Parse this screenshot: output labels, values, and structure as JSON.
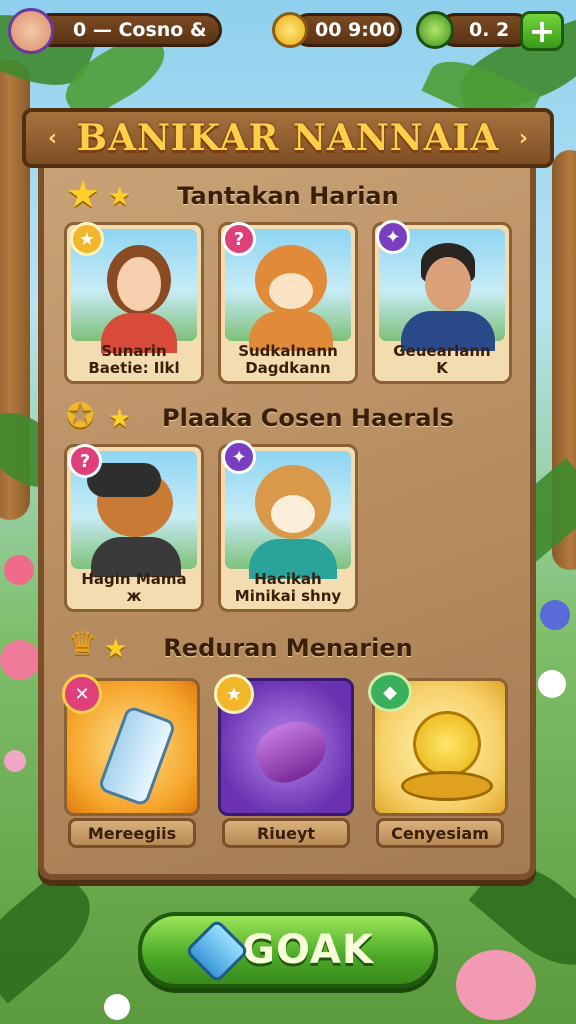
{
  "topbar": {
    "player_name": "0 — Cosno &",
    "coins": "00 9:00",
    "gems": "0. 2",
    "add_icon": "plus-icon"
  },
  "banner": {
    "title": "BANIKAR NANNAIA"
  },
  "sections": [
    {
      "title": "Tantakan Harian",
      "cards": [
        {
          "name": "Sunarin",
          "sub": "Baetie: Ilkl",
          "badge": "star"
        },
        {
          "name": "Sudkalnann",
          "sub": "Dagdkann",
          "badge": "?"
        },
        {
          "name": "Geuearlann",
          "sub": "K",
          "badge": "✦"
        }
      ]
    },
    {
      "title": "Plaaka Cosen Haerals",
      "cards": [
        {
          "name": "Hagin Mama",
          "sub": "ж",
          "badge": "?"
        },
        {
          "name": "Hacikah",
          "sub": "Minikai shny",
          "badge": "✦"
        }
      ]
    }
  ],
  "rewards": {
    "title": "Reduran Menarien",
    "items": [
      {
        "label": "Mereegiis",
        "icon": "potion-bottle-icon"
      },
      {
        "label": "Riueyt",
        "icon": "magic-horn-icon"
      },
      {
        "label": "Cenyesiam",
        "icon": "gold-trophy-icon"
      }
    ]
  },
  "action_button": {
    "label": "GOAK"
  },
  "colors": {
    "wood": "#b48a5e",
    "title_gold": "#ffcf4a",
    "button_green": "#4aa826",
    "badge_pink": "#e0407a",
    "badge_purple": "#7a3fc0"
  }
}
